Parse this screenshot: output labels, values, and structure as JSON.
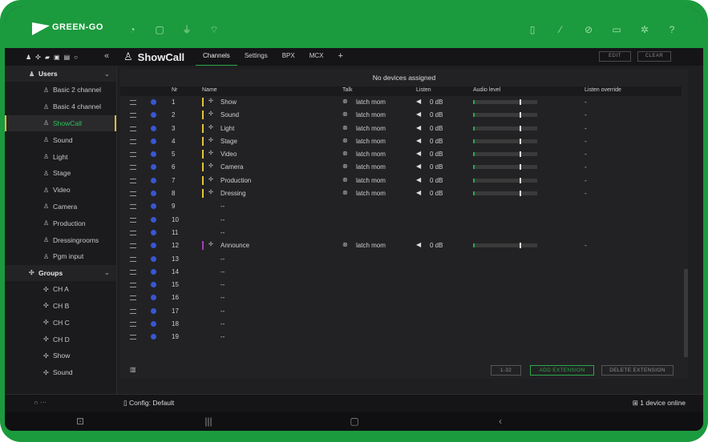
{
  "brand": {
    "name": "GREEN-GO",
    "accent": "#1c9a3e"
  },
  "topbar": {
    "left_icons": [
      "dashboard-icon",
      "document-icon",
      "network-icon",
      "wifi-icon"
    ],
    "right_icons": [
      "beltpack-icon",
      "wand-icon",
      "eye-off-icon",
      "folder-icon",
      "settings-icon",
      "help-icon"
    ]
  },
  "sidebar_toolbar": {
    "icons": [
      "user-icon",
      "group-icon",
      "device-icon",
      "save-icon",
      "tablet-icon",
      "search-icon"
    ],
    "collapse": "«"
  },
  "page": {
    "title": "ShowCall"
  },
  "tabs": [
    {
      "label": "Channels",
      "active": true
    },
    {
      "label": "Settings",
      "active": false
    },
    {
      "label": "BPX",
      "active": false
    },
    {
      "label": "MCX",
      "active": false
    },
    {
      "label": "+",
      "active": false
    }
  ],
  "actions": {
    "edit": "EDIT",
    "clear": "CLEAR"
  },
  "sidebar": {
    "users_label": "Users",
    "users": [
      "Basic 2 channel",
      "Basic 4 channel",
      "ShowCall",
      "Sound",
      "Light",
      "Stage",
      "Video",
      "Camera",
      "Production",
      "Dressingrooms",
      "Pgm input"
    ],
    "selected_user": "ShowCall",
    "groups_label": "Groups",
    "groups": [
      "CH A",
      "CH B",
      "CH C",
      "CH D",
      "Show",
      "Sound"
    ]
  },
  "main": {
    "notice": "No devices assigned",
    "columns": {
      "nr": "Nr",
      "name": "Name",
      "talk": "Talk",
      "listen": "Listen",
      "audio": "Audio level",
      "override": "Listen override"
    },
    "rows": [
      {
        "nr": "1",
        "name": "Show",
        "color": "#e2c53b",
        "talk": "latch mom",
        "listen": "0 dB",
        "override": "-"
      },
      {
        "nr": "2",
        "name": "Sound",
        "color": "#e2c53b",
        "talk": "latch mom",
        "listen": "0 dB",
        "override": "-"
      },
      {
        "nr": "3",
        "name": "Light",
        "color": "#e2c53b",
        "talk": "latch mom",
        "listen": "0 dB",
        "override": "-"
      },
      {
        "nr": "4",
        "name": "Stage",
        "color": "#e2c53b",
        "talk": "latch mom",
        "listen": "0 dB",
        "override": "-"
      },
      {
        "nr": "5",
        "name": "Video",
        "color": "#e2c53b",
        "talk": "latch mom",
        "listen": "0 dB",
        "override": "-"
      },
      {
        "nr": "6",
        "name": "Camera",
        "color": "#e2c53b",
        "talk": "latch mom",
        "listen": "0 dB",
        "override": "-"
      },
      {
        "nr": "7",
        "name": "Production",
        "color": "#e2c53b",
        "talk": "latch mom",
        "listen": "0 dB",
        "override": "-"
      },
      {
        "nr": "8",
        "name": "Dressing",
        "color": "#e2c53b",
        "talk": "latch mom",
        "listen": "0 dB",
        "override": "-"
      },
      {
        "nr": "9",
        "name": "--",
        "color": "",
        "talk": "",
        "listen": "",
        "override": ""
      },
      {
        "nr": "10",
        "name": "--",
        "color": "",
        "talk": "",
        "listen": "",
        "override": ""
      },
      {
        "nr": "11",
        "name": "--",
        "color": "",
        "talk": "",
        "listen": "",
        "override": ""
      },
      {
        "nr": "12",
        "name": "Announce",
        "color": "#a43fb8",
        "talk": "latch mom",
        "listen": "0 dB",
        "override": "-"
      },
      {
        "nr": "13",
        "name": "--",
        "color": "",
        "talk": "",
        "listen": "",
        "override": ""
      },
      {
        "nr": "14",
        "name": "--",
        "color": "",
        "talk": "",
        "listen": "",
        "override": ""
      },
      {
        "nr": "15",
        "name": "--",
        "color": "",
        "talk": "",
        "listen": "",
        "override": ""
      },
      {
        "nr": "16",
        "name": "--",
        "color": "",
        "talk": "",
        "listen": "",
        "override": ""
      },
      {
        "nr": "17",
        "name": "--",
        "color": "",
        "talk": "",
        "listen": "",
        "override": ""
      },
      {
        "nr": "18",
        "name": "--",
        "color": "",
        "talk": "",
        "listen": "",
        "override": ""
      },
      {
        "nr": "19",
        "name": "--",
        "color": "",
        "talk": "",
        "listen": "",
        "override": ""
      }
    ]
  },
  "pagination": {
    "range": "1-32",
    "add": "ADD EXTENSION",
    "delete": "DELETE EXTENSION"
  },
  "status": {
    "config": "Config: Default",
    "online": "1 device online"
  },
  "navbar": {
    "icons": [
      "screenshot-icon",
      "recents-icon",
      "home-icon",
      "back-icon"
    ]
  }
}
